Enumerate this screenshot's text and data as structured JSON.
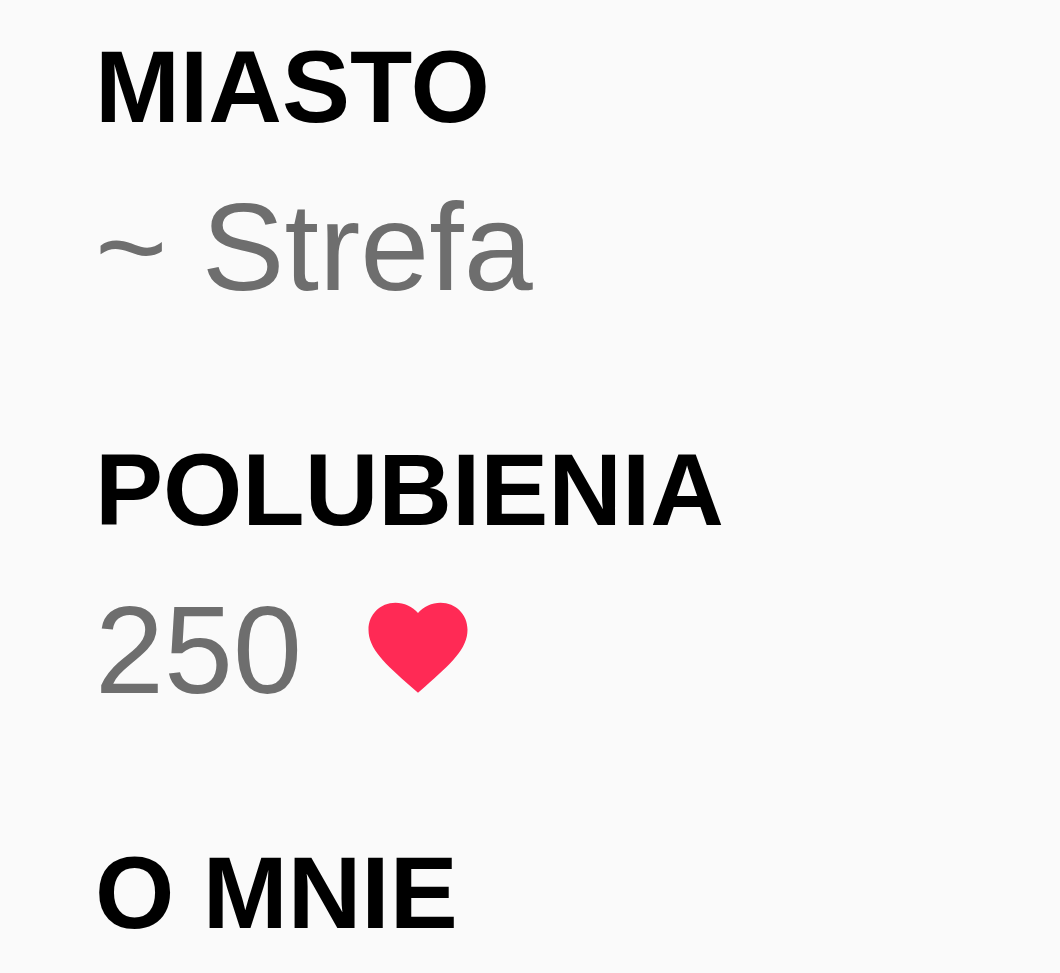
{
  "sections": [
    {
      "label": "MIASTO",
      "kind": "text",
      "value": "~ Strefa"
    },
    {
      "label": "POLUBIENIA",
      "kind": "likes",
      "value": "250"
    },
    {
      "label": "O MNIE"
    }
  ]
}
